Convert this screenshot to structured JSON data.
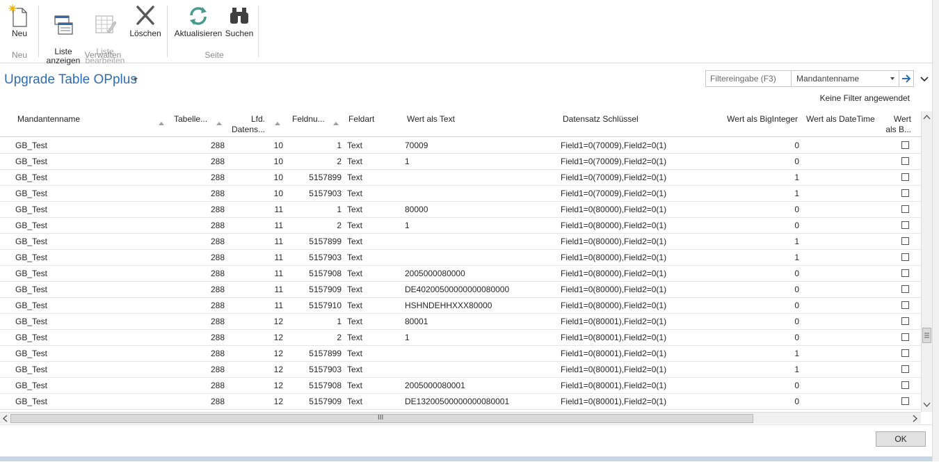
{
  "ribbon": {
    "buttons": [
      {
        "label": "Neu",
        "icon": "new-document-icon"
      },
      {
        "label": "Liste\nanzeigen",
        "icon": "show-list-icon"
      },
      {
        "label": "Liste\nbearbeiten",
        "icon": "edit-list-icon",
        "disabled": true
      },
      {
        "label": "Löschen",
        "icon": "delete-x-icon"
      },
      {
        "label": "Aktualisieren",
        "icon": "refresh-icon"
      },
      {
        "label": "Suchen",
        "icon": "binoculars-icon"
      }
    ],
    "groups": [
      "Neu",
      "Verwalten",
      "Seite"
    ]
  },
  "page": {
    "title": "Upgrade Table OPplus"
  },
  "filter": {
    "placeholder": "Filtereingabe (F3)",
    "field": "Mandantenname",
    "status": "Keine Filter angewendet"
  },
  "columns": {
    "mandant": "Mandantenname",
    "tabelle": "Tabelle...",
    "lfd": "Lfd.\nDatens...",
    "feldnr": "Feldnu...",
    "feldart": "Feldart",
    "wert_text": "Wert als Text",
    "schluessel": "Datensatz Schlüssel",
    "bigint": "Wert als BigInteger",
    "datetime": "Wert als DateTime",
    "bool": "Wert\nals B..."
  },
  "rows": [
    {
      "mandant": "GB_Test",
      "tabelle": "288",
      "lfd": "10",
      "feldnr": "1",
      "feldart": "Text",
      "wert": "70009",
      "key": "Field1=0(70009),Field2=0(1)",
      "bigint": "0",
      "checked": false
    },
    {
      "mandant": "GB_Test",
      "tabelle": "288",
      "lfd": "10",
      "feldnr": "2",
      "feldart": "Text",
      "wert": "1",
      "key": "Field1=0(70009),Field2=0(1)",
      "bigint": "0",
      "checked": false
    },
    {
      "mandant": "GB_Test",
      "tabelle": "288",
      "lfd": "10",
      "feldnr": "5157899",
      "feldart": "Text",
      "wert": "",
      "key": "Field1=0(70009),Field2=0(1)",
      "bigint": "1",
      "checked": false
    },
    {
      "mandant": "GB_Test",
      "tabelle": "288",
      "lfd": "10",
      "feldnr": "5157903",
      "feldart": "Text",
      "wert": "",
      "key": "Field1=0(70009),Field2=0(1)",
      "bigint": "1",
      "checked": false
    },
    {
      "mandant": "GB_Test",
      "tabelle": "288",
      "lfd": "11",
      "feldnr": "1",
      "feldart": "Text",
      "wert": "80000",
      "key": "Field1=0(80000),Field2=0(1)",
      "bigint": "0",
      "checked": false
    },
    {
      "mandant": "GB_Test",
      "tabelle": "288",
      "lfd": "11",
      "feldnr": "2",
      "feldart": "Text",
      "wert": "1",
      "key": "Field1=0(80000),Field2=0(1)",
      "bigint": "0",
      "checked": false
    },
    {
      "mandant": "GB_Test",
      "tabelle": "288",
      "lfd": "11",
      "feldnr": "5157899",
      "feldart": "Text",
      "wert": "",
      "key": "Field1=0(80000),Field2=0(1)",
      "bigint": "1",
      "checked": false
    },
    {
      "mandant": "GB_Test",
      "tabelle": "288",
      "lfd": "11",
      "feldnr": "5157903",
      "feldart": "Text",
      "wert": "",
      "key": "Field1=0(80000),Field2=0(1)",
      "bigint": "1",
      "checked": false
    },
    {
      "mandant": "GB_Test",
      "tabelle": "288",
      "lfd": "11",
      "feldnr": "5157908",
      "feldart": "Text",
      "wert": "2005000080000",
      "key": "Field1=0(80000),Field2=0(1)",
      "bigint": "0",
      "checked": false
    },
    {
      "mandant": "GB_Test",
      "tabelle": "288",
      "lfd": "11",
      "feldnr": "5157909",
      "feldart": "Text",
      "wert": "DE40200500000000080000",
      "key": "Field1=0(80000),Field2=0(1)",
      "bigint": "0",
      "checked": false
    },
    {
      "mandant": "GB_Test",
      "tabelle": "288",
      "lfd": "11",
      "feldnr": "5157910",
      "feldart": "Text",
      "wert": "HSHNDEHHXXX80000",
      "key": "Field1=0(80000),Field2=0(1)",
      "bigint": "0",
      "checked": false
    },
    {
      "mandant": "GB_Test",
      "tabelle": "288",
      "lfd": "12",
      "feldnr": "1",
      "feldart": "Text",
      "wert": "80001",
      "key": "Field1=0(80001),Field2=0(1)",
      "bigint": "0",
      "checked": false
    },
    {
      "mandant": "GB_Test",
      "tabelle": "288",
      "lfd": "12",
      "feldnr": "2",
      "feldart": "Text",
      "wert": "1",
      "key": "Field1=0(80001),Field2=0(1)",
      "bigint": "0",
      "checked": false
    },
    {
      "mandant": "GB_Test",
      "tabelle": "288",
      "lfd": "12",
      "feldnr": "5157899",
      "feldart": "Text",
      "wert": "",
      "key": "Field1=0(80001),Field2=0(1)",
      "bigint": "1",
      "checked": false
    },
    {
      "mandant": "GB_Test",
      "tabelle": "288",
      "lfd": "12",
      "feldnr": "5157903",
      "feldart": "Text",
      "wert": "",
      "key": "Field1=0(80001),Field2=0(1)",
      "bigint": "1",
      "checked": false
    },
    {
      "mandant": "GB_Test",
      "tabelle": "288",
      "lfd": "12",
      "feldnr": "5157908",
      "feldart": "Text",
      "wert": "2005000080001",
      "key": "Field1=0(80001),Field2=0(1)",
      "bigint": "0",
      "checked": false
    },
    {
      "mandant": "GB_Test",
      "tabelle": "288",
      "lfd": "12",
      "feldnr": "5157909",
      "feldart": "Text",
      "wert": "DE13200500000000080001",
      "key": "Field1=0(80001),Field2=0(1)",
      "bigint": "0",
      "checked": false
    }
  ],
  "scroll": {
    "h_grip": "III"
  },
  "ok_label": "OK",
  "colors": {
    "title": "#2f6db2",
    "accent": "#2f6db2",
    "refresh": "#4a9a8c"
  }
}
